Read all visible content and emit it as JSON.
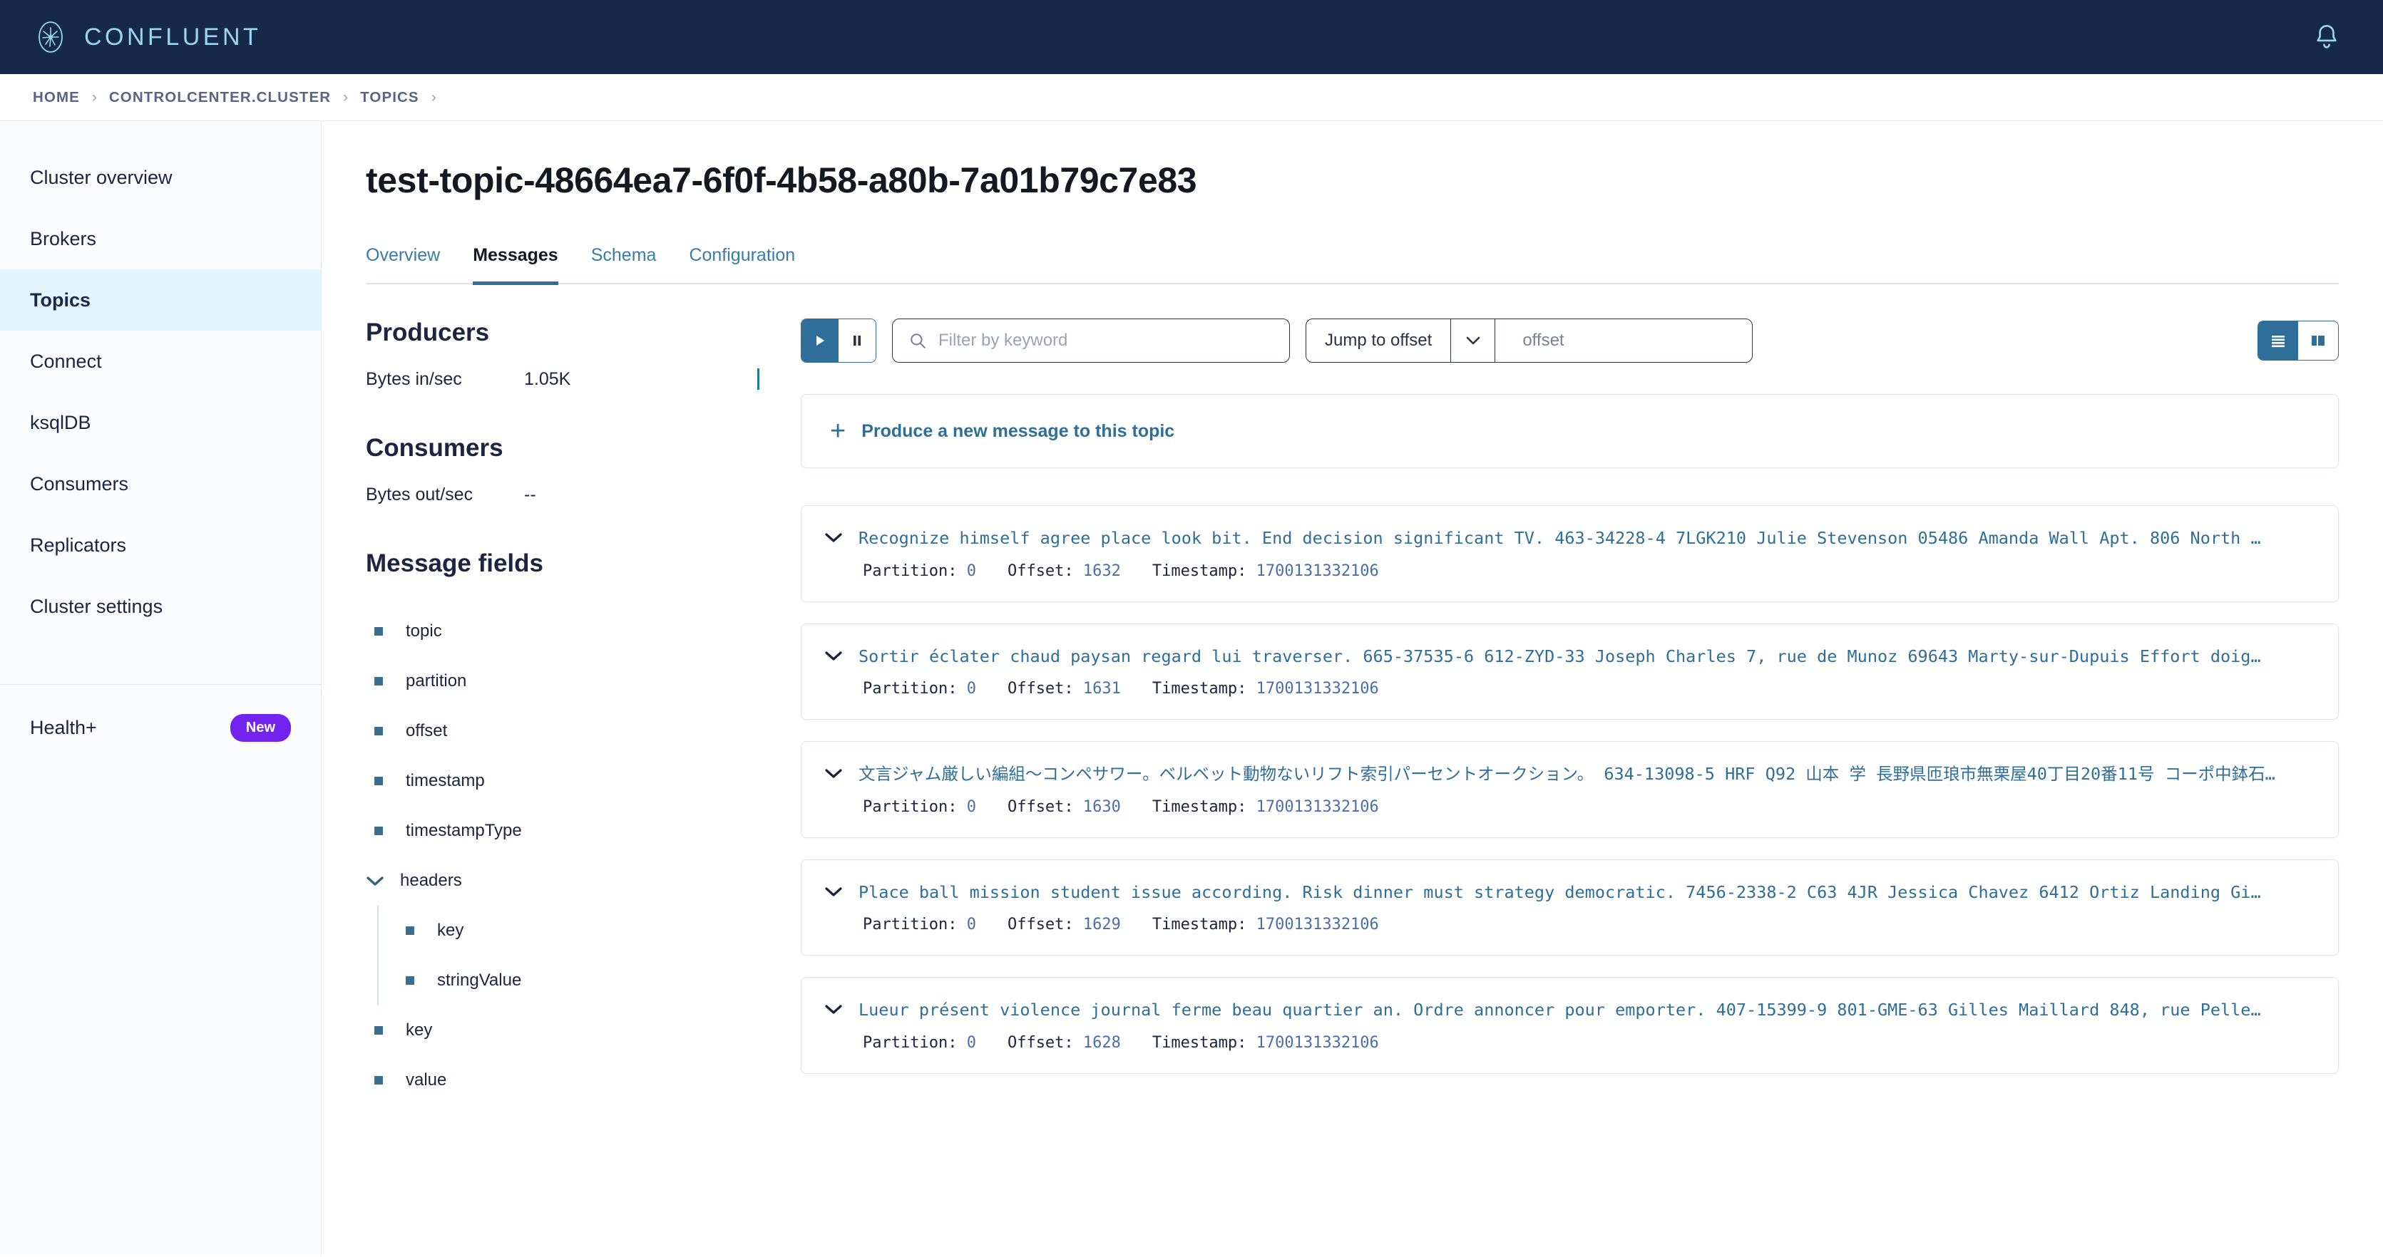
{
  "topbar": {
    "brand_name": "CONFLUENT",
    "logo_icon": "confluent-logo-icon",
    "notification_icon": "bell-icon"
  },
  "breadcrumb": {
    "items": [
      "HOME",
      "CONTROLCENTER.CLUSTER",
      "TOPICS"
    ],
    "separator": "›"
  },
  "sidebar": {
    "items": [
      {
        "label": "Cluster overview",
        "active": false
      },
      {
        "label": "Brokers",
        "active": false
      },
      {
        "label": "Topics",
        "active": true
      },
      {
        "label": "Connect",
        "active": false
      },
      {
        "label": "ksqlDB",
        "active": false
      },
      {
        "label": "Consumers",
        "active": false
      },
      {
        "label": "Replicators",
        "active": false
      },
      {
        "label": "Cluster settings",
        "active": false
      }
    ],
    "health": {
      "label": "Health+",
      "badge": "New"
    }
  },
  "page": {
    "title": "test-topic-48664ea7-6f0f-4b58-a80b-7a01b79c7e83",
    "tabs": [
      {
        "label": "Overview",
        "active": false
      },
      {
        "label": "Messages",
        "active": true
      },
      {
        "label": "Schema",
        "active": false
      },
      {
        "label": "Configuration",
        "active": false
      }
    ]
  },
  "metrics": {
    "producers_title": "Producers",
    "producers_metric_label": "Bytes in/sec",
    "producers_metric_value": "1.05K",
    "consumers_title": "Consumers",
    "consumers_metric_label": "Bytes out/sec",
    "consumers_metric_value": "--",
    "fields_title": "Message fields",
    "fields": [
      {
        "label": "topic",
        "type": "leaf"
      },
      {
        "label": "partition",
        "type": "leaf"
      },
      {
        "label": "offset",
        "type": "leaf"
      },
      {
        "label": "timestamp",
        "type": "leaf"
      },
      {
        "label": "timestampType",
        "type": "leaf"
      },
      {
        "label": "headers",
        "type": "group",
        "expanded": true,
        "children": [
          {
            "label": "key"
          },
          {
            "label": "stringValue"
          }
        ]
      },
      {
        "label": "key",
        "type": "leaf"
      },
      {
        "label": "value",
        "type": "leaf"
      }
    ]
  },
  "toolbar": {
    "play_icon": "play-icon",
    "pause_icon": "pause-icon",
    "filter_placeholder": "Filter by keyword",
    "filter_value": "",
    "search_icon": "search-icon",
    "jump_mode_label": "Jump to offset",
    "jump_caret_icon": "chevron-down-icon",
    "offset_placeholder": "offset",
    "offset_value": "",
    "view_list_icon": "list-view-icon",
    "view_card_icon": "card-view-icon"
  },
  "produce": {
    "plus_icon": "plus-icon",
    "label": "Produce a new message to this topic"
  },
  "messages": {
    "meta_labels": {
      "partition": "Partition:",
      "offset": "Offset:",
      "timestamp": "Timestamp:"
    },
    "chevron_icon": "chevron-down-icon",
    "items": [
      {
        "preview": "Recognize himself agree place look bit. End decision significant TV. 463-34228-4 7LGK210 Julie Stevenson 05486 Amanda Wall Apt. 806 North …",
        "partition": "0",
        "offset": "1632",
        "timestamp": "1700131332106"
      },
      {
        "preview": "Sortir éclater chaud paysan regard lui traverser. 665-37535-6 612-ZYD-33 Joseph Charles 7, rue de Munoz 69643 Marty-sur-Dupuis Effort doig…",
        "partition": "0",
        "offset": "1631",
        "timestamp": "1700131332106"
      },
      {
        "preview": "文言ジャム厳しい編組～コンペサワー。ベルベット動物ないリフト索引パーセントオークション。 634-13098-5 HRF Q92 山本 学 長野県匝琅市無栗屋40丁目20番11号 コーポ中鉢石…",
        "partition": "0",
        "offset": "1630",
        "timestamp": "1700131332106"
      },
      {
        "preview": "Place ball mission student issue according. Risk dinner must strategy democratic. 7456-2338-2 C63 4JR Jessica Chavez 6412 Ortiz Landing Gi…",
        "partition": "0",
        "offset": "1629",
        "timestamp": "1700131332106"
      },
      {
        "preview": "Lueur présent violence journal ferme beau quartier an. Ordre annoncer pour emporter. 407-15399-9 801-GME-63 Gilles Maillard 848, rue Pelle…",
        "partition": "0",
        "offset": "1628",
        "timestamp": "1700131332106"
      }
    ]
  },
  "colors": {
    "navy": "#16294b",
    "accent_blue": "#2e6e99",
    "active_nav_bg": "#e3f4fc",
    "badge_purple": "#7223f0",
    "spark_teal": "#1b7f8e"
  }
}
